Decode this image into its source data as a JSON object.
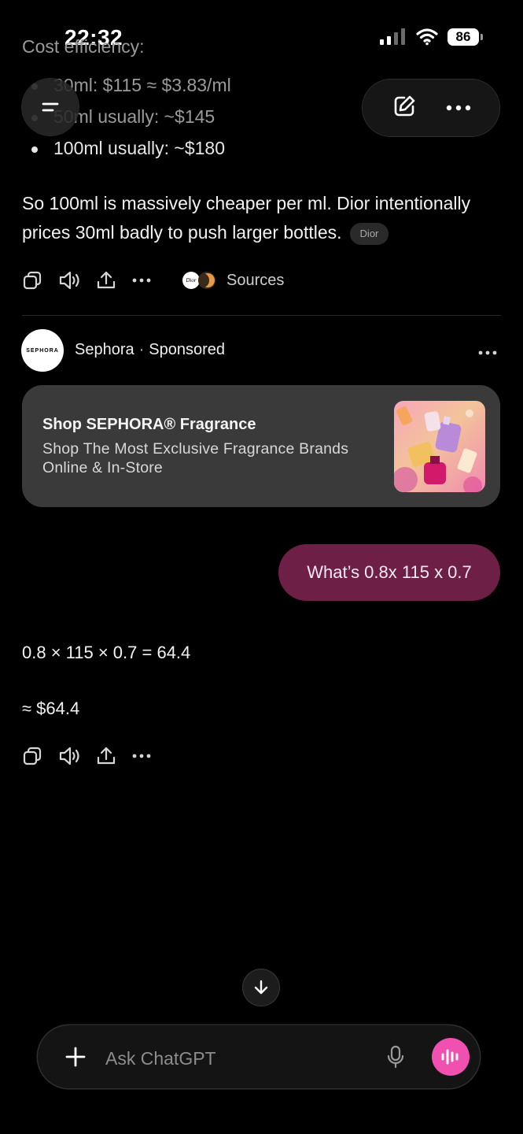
{
  "status_bar": {
    "time": "22:32",
    "battery": "86"
  },
  "conversation": {
    "faded_heading": "Cost efficiency:",
    "faded_bullets": [
      "30ml: $115 ≈ $3.83/ml",
      "50ml usually: ~$145"
    ],
    "bullet": "100ml usually: ~$180",
    "paragraph": "So 100ml is massively cheaper per ml. Dior intentionally prices 30ml badly to push larger bottles.",
    "source_chip": "Dior",
    "sources_label": "Sources",
    "source_logo_text": "Dior"
  },
  "sponsor": {
    "logo_text": "SEPHORA",
    "name": "Sephora",
    "separator": "·",
    "label": "Sponsored"
  },
  "ad": {
    "title": "Shop SEPHORA® Fragrance",
    "description": "Shop The Most Exclusive Fragrance Brands Online & In-Store"
  },
  "user_message": "What’s 0.8x 115 x 0.7",
  "assistant": {
    "line1": "0.8 × 115 × 0.7 = 64.4",
    "line2": "≈ $64.4"
  },
  "composer": {
    "placeholder": "Ask ChatGPT"
  },
  "colors": {
    "background": "#000000",
    "user_bubble": "#6e1f46",
    "voice_button": "#f050b0",
    "ad_card": "#3a3a3a"
  },
  "icons": [
    "menu-icon",
    "new-chat-icon",
    "more-icon",
    "copy-icon",
    "speaker-icon",
    "share-icon",
    "plus-icon",
    "mic-icon",
    "voice-wave-icon",
    "arrow-down-icon"
  ]
}
